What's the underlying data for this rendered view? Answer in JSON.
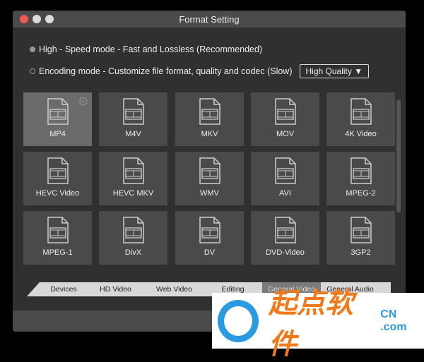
{
  "window": {
    "title": "Format Setting"
  },
  "modes": [
    {
      "label": "High - Speed mode - Fast and Lossless (Recommended)",
      "selected": true
    },
    {
      "label": "Encoding mode - Customize file format, quality and codec (Slow)",
      "selected": false
    }
  ],
  "quality_select": {
    "value": "High Quality ▼"
  },
  "formats": [
    "MP4",
    "M4V",
    "MKV",
    "MOV",
    "4K Video",
    "HEVC Video",
    "HEVC MKV",
    "WMV",
    "AVI",
    "MPEG-2",
    "MPEG-1",
    "DivX",
    "DV",
    "DVD-Video",
    "3GP2"
  ],
  "tabs": [
    "Devices",
    "HD Video",
    "Web Video",
    "Editing",
    "General Video",
    "General Audio"
  ],
  "active_tab": "General Video",
  "watermark": {
    "text": "起点软件",
    "suffix": "CN .com"
  }
}
